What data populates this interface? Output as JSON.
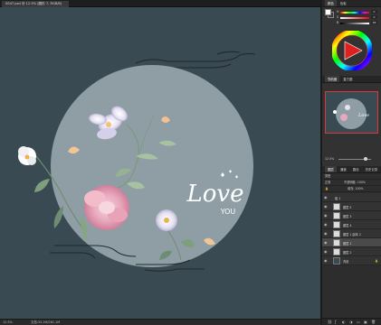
{
  "document": {
    "tab_title": "0047.psd @ 12.5% (圆形 7, RGB/8)",
    "close_glyph": "×"
  },
  "artwork": {
    "script_text": "Love",
    "sub_text": "YOU",
    "background_color": "#3a4a52",
    "circle_color": "#8f9ea5"
  },
  "status": {
    "zoom": "12.5%",
    "doc_info": "文档:33.2M/261.1M"
  },
  "color_panel": {
    "tabs": [
      "颜色",
      "色板"
    ],
    "sliders": [
      {
        "label": "H",
        "value": "0"
      },
      {
        "label": "S",
        "value": "0"
      },
      {
        "label": "B",
        "value": "98"
      }
    ]
  },
  "navigator": {
    "tabs": [
      "导航器",
      "直方图"
    ],
    "zoom": "12.5%"
  },
  "layers_panel": {
    "tabs": [
      "图层",
      "通道",
      "路径",
      "历史记录"
    ],
    "kind_label": "类型",
    "blend_mode": "正常",
    "opacity_label": "不透明度: 100%",
    "fill_label": "填充: 100%",
    "group_name": "组 1",
    "layers": [
      {
        "name": "图层 5"
      },
      {
        "name": "图层 3"
      },
      {
        "name": "图层 4"
      },
      {
        "name": "图层 1 副本 2"
      },
      {
        "name": "图层 1"
      },
      {
        "name": "图层 2"
      },
      {
        "name": "背景"
      }
    ]
  },
  "icons": {
    "eye": "eye-icon",
    "lock": "lock-icon",
    "link": "link-icon",
    "fx": "fx-icon",
    "new_layer": "new-layer-icon",
    "trash": "trash-icon"
  }
}
